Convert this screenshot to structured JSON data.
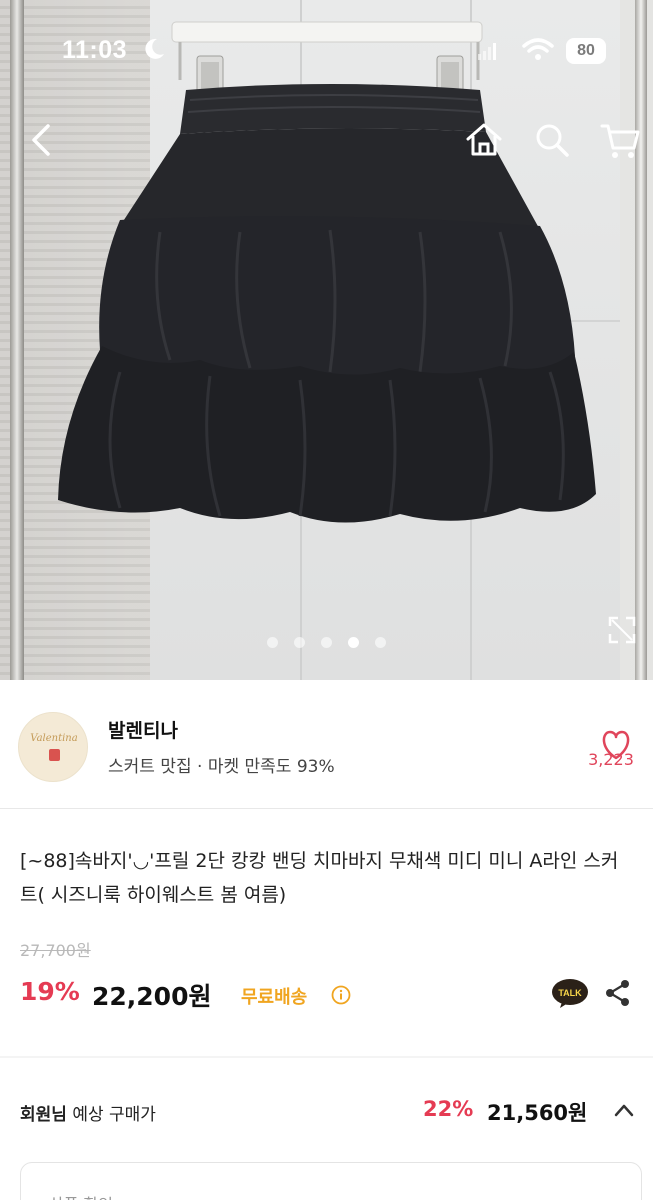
{
  "status_bar": {
    "time": "11:03",
    "battery": "80"
  },
  "nav": {
    "back_icon": "chevron-left-icon",
    "home_icon": "home-icon",
    "search_icon": "search-icon",
    "cart_icon": "cart-icon"
  },
  "gallery": {
    "image_count": 5,
    "active_index": 3,
    "expand_icon": "expand-icon"
  },
  "seller": {
    "logo_text": "Valentina",
    "name": "발렌티나",
    "description": "스커트 맛집 · 마켓 만족도 93%",
    "like_count": "3,223"
  },
  "product": {
    "title": "[~88]속바지'◡'프릴 2단 캉캉 밴딩 치마바지 무채색 미디 미니 A라인 스커트( 시즈니룩 하이웨스트 봄 여름)",
    "original_price": "27,700원",
    "discount": "19%",
    "price": "22,200원",
    "shipping": "무료배송"
  },
  "member": {
    "label_bold": "회원님",
    "label_rest": " 예상 구매가",
    "discount": "22%",
    "price": "21,560원"
  },
  "coupon": {
    "label": "상품 할인"
  },
  "colors": {
    "accent_red": "#e53b53",
    "shipping_orange": "#f0a520",
    "like_pink": "#e0455b"
  }
}
